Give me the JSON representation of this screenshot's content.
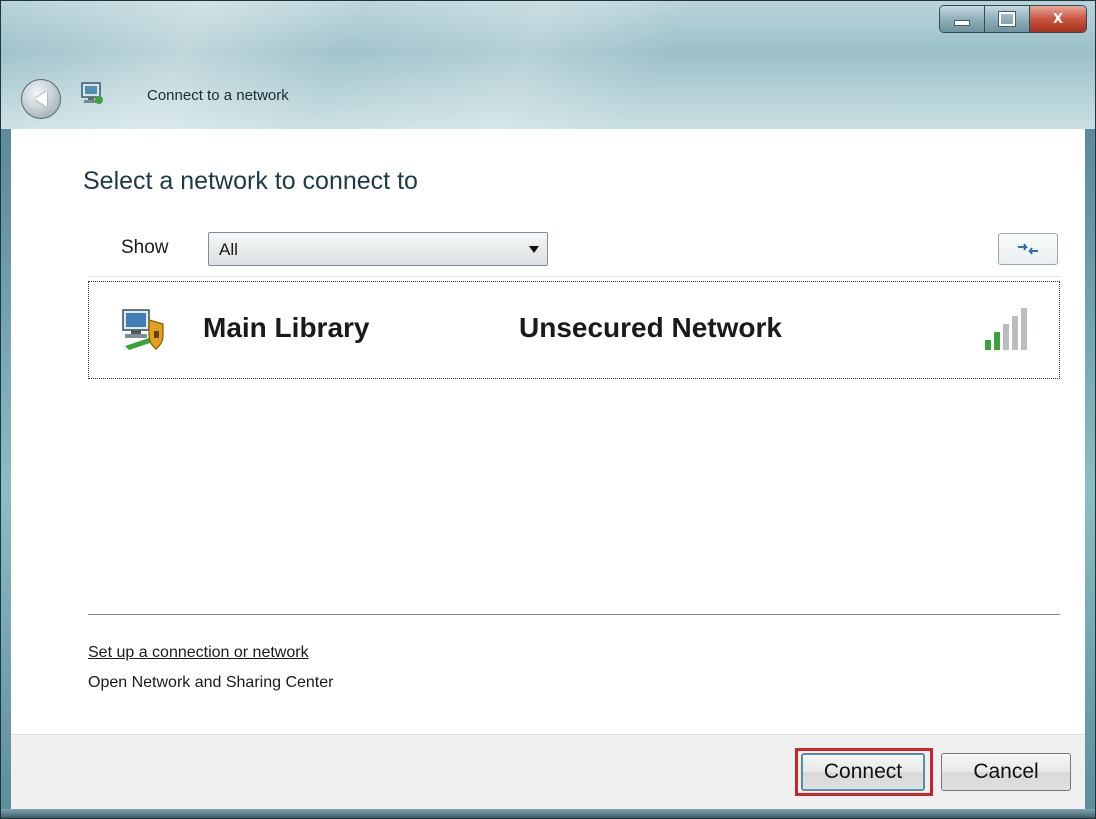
{
  "window": {
    "title": "Connect to a network",
    "controls": {
      "minimize": "",
      "maximize": "",
      "close": "X"
    }
  },
  "main": {
    "heading": "Select a network to connect to",
    "show_label": "Show",
    "show_selected": "All"
  },
  "networks": [
    {
      "name": "Main Library",
      "security": "Unsecured Network",
      "signal_bars": 5,
      "signal_strength_filled": 2
    }
  ],
  "links": {
    "setup": "Set up a connection or network",
    "open_center": "Open Network and Sharing Center"
  },
  "buttons": {
    "connect": "Connect",
    "cancel": "Cancel"
  },
  "colors": {
    "highlight_frame": "#c8262c",
    "signal_active": "#3aa33a",
    "signal_inactive": "#b9bdbf"
  }
}
